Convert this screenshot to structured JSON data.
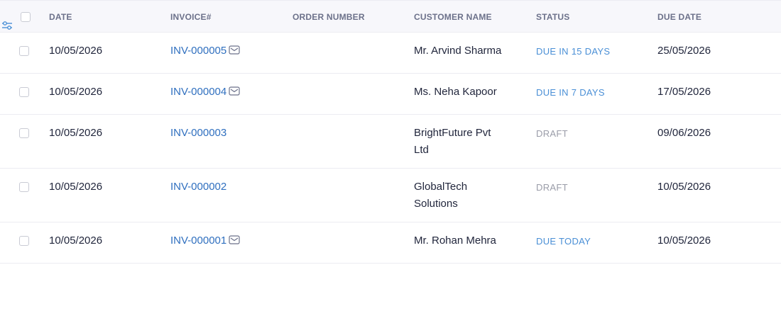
{
  "header": {
    "date": "DATE",
    "invoice": "INVOICE#",
    "order_number": "ORDER NUMBER",
    "customer_name": "CUSTOMER NAME",
    "status": "STATUS",
    "due_date": "DUE DATE"
  },
  "rows": [
    {
      "date": "10/05/2026",
      "invoice": "INV-000005",
      "emailed": true,
      "order_number": "",
      "customer": "Mr. Arvind Sharma",
      "status": "DUE IN 15 DAYS",
      "status_type": "due",
      "due_date": "25/05/2026"
    },
    {
      "date": "10/05/2026",
      "invoice": "INV-000004",
      "emailed": true,
      "order_number": "",
      "customer": "Ms. Neha Kapoor",
      "status": "DUE IN 7 DAYS",
      "status_type": "due",
      "due_date": "17/05/2026"
    },
    {
      "date": "10/05/2026",
      "invoice": "INV-000003",
      "emailed": false,
      "order_number": "",
      "customer": "BrightFuture Pvt Ltd",
      "status": "DRAFT",
      "status_type": "draft",
      "due_date": "09/06/2026"
    },
    {
      "date": "10/05/2026",
      "invoice": "INV-000002",
      "emailed": false,
      "order_number": "",
      "customer": "GlobalTech Solutions",
      "status": "DRAFT",
      "status_type": "draft",
      "due_date": "10/05/2026"
    },
    {
      "date": "10/05/2026",
      "invoice": "INV-000001",
      "emailed": true,
      "order_number": "",
      "customer": "Mr. Rohan Mehra",
      "status": "DUE TODAY",
      "status_type": "due",
      "due_date": "10/05/2026"
    }
  ],
  "colors": {
    "link": "#2f6fbf",
    "status_due": "#4a8fd6",
    "status_draft": "#9a9ca8",
    "header_bg": "#f7f7fb"
  },
  "icons": {
    "filter": "filter-sliders-icon",
    "email": "envelope-icon"
  }
}
